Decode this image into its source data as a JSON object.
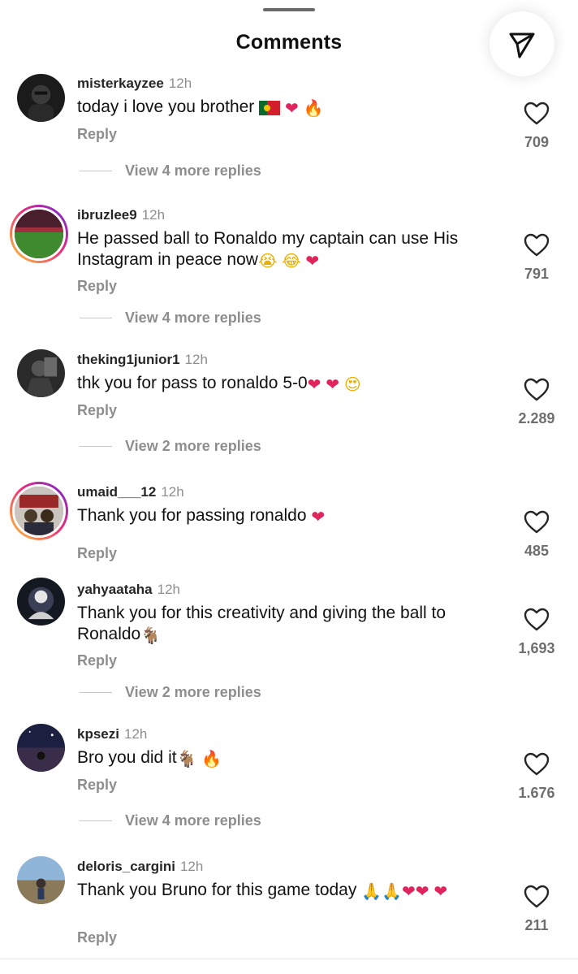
{
  "header": {
    "title": "Comments"
  },
  "icons": {
    "send": "send-paper-plane-icon",
    "like": "heart-outline-icon"
  },
  "comments": [
    {
      "user": "misterkayzee",
      "time": "12h",
      "text": "today i love you brother",
      "emojis": [
        "portugal-flag",
        "red-heart",
        "fire"
      ],
      "reply": "Reply",
      "likes": "709",
      "view_more": "View 4 more replies"
    },
    {
      "user": "ibruzlee9",
      "time": "12h",
      "text": "He passed ball to Ronaldo  my captain can use His Instagram in peace now",
      "emojis": [
        "loudly-crying-face",
        "tears-of-joy",
        "red-heart"
      ],
      "reply": "Reply",
      "likes": "791",
      "view_more": "View 4 more replies"
    },
    {
      "user": "theking1junior1",
      "time": "12h",
      "text": "thk you for pass to ronaldo 5-0",
      "emojis": [
        "red-heart",
        "red-heart",
        "heart-eyes"
      ],
      "reply": "Reply",
      "likes": "2.289",
      "view_more": "View 2 more replies"
    },
    {
      "user": "umaid___12",
      "time": "12h",
      "text": "Thank you for passing ronaldo",
      "emojis": [
        "red-heart"
      ],
      "reply": "Reply",
      "likes": "485"
    },
    {
      "user": "yahyaataha",
      "time": "12h",
      "text": "Thank you for this creativity and giving the ball to Ronaldo",
      "emojis": [
        "goat"
      ],
      "reply": "Reply",
      "likes": "1,693",
      "view_more": "View 2 more replies"
    },
    {
      "user": "kpsezi",
      "time": "12h",
      "text": "Bro you did it",
      "emojis": [
        "goat",
        "fire"
      ],
      "reply": "Reply",
      "likes": "1.676",
      "view_more": "View 4 more replies"
    },
    {
      "user": "deloris_cargini",
      "time": "12h",
      "text": "Thank you Bruno for this game today",
      "emojis": [
        "folded-hands",
        "folded-hands",
        "red-heart",
        "red-heart",
        "red-heart"
      ],
      "reply": "Reply",
      "likes": "211"
    }
  ],
  "colors": {
    "heart": "#e0245e",
    "secondary_text": "#8e8e8e",
    "story_ring_start": "#f9ce34",
    "story_ring_mid": "#ee2a7b",
    "story_ring_end": "#6228d7"
  }
}
